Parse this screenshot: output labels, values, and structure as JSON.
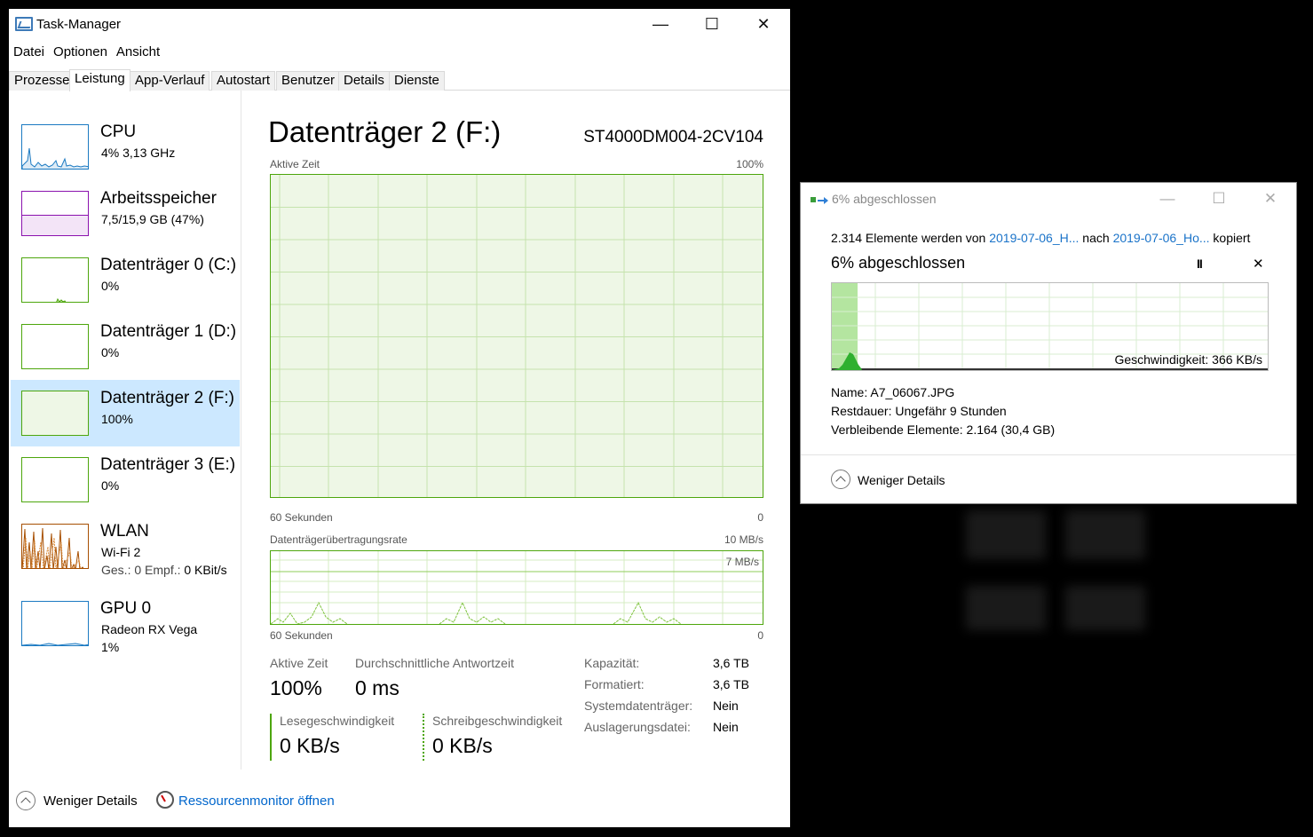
{
  "window": {
    "title": "Task-Manager",
    "minimize": "—",
    "maximize": "☐",
    "close": "✕"
  },
  "menu": [
    "Datei",
    "Optionen",
    "Ansicht"
  ],
  "tabs": [
    "Prozesse",
    "Leistung",
    "App-Verlauf",
    "Autostart",
    "Benutzer",
    "Details",
    "Dienste"
  ],
  "sidebar": {
    "items": [
      {
        "name": "CPU",
        "sub": "4%  3,13 GHz",
        "color": "#1b7ac2"
      },
      {
        "name": "Arbeitsspeicher",
        "sub": "7,5/15,9 GB (47%)",
        "color": "#8b12ae"
      },
      {
        "name": "Datenträger 0 (C:)",
        "sub": "0%",
        "color": "#4da60c"
      },
      {
        "name": "Datenträger 1 (D:)",
        "sub": "0%",
        "color": "#4da60c"
      },
      {
        "name": "Datenträger 2 (F:)",
        "sub": "100%",
        "color": "#4da60c"
      },
      {
        "name": "Datenträger 3 (E:)",
        "sub": "0%",
        "color": "#4da60c"
      },
      {
        "name": "WLAN",
        "sub": "Wi-Fi 2",
        "sub2_a": "Ges.: 0",
        "sub2_b": " Empf.: ",
        "sub2_c": "0 KBit/s",
        "color": "#a74f01"
      },
      {
        "name": "GPU 0",
        "sub": "Radeon RX Vega",
        "sub2": "1%",
        "color": "#1b7ac2"
      }
    ]
  },
  "main": {
    "title": "Datenträger 2 (F:)",
    "model": "ST4000DM004-2CV104",
    "graph1": {
      "label": "Aktive Zeit",
      "max": "100%",
      "xlabel": "60 Sekunden",
      "xmin": "0"
    },
    "graph2": {
      "label": "Datenträgerübertragungsrate",
      "max": "10 MB/s",
      "inner": "7 MB/s",
      "xlabel": "60 Sekunden",
      "xmin": "0"
    },
    "stats": {
      "active_label": "Aktive Zeit",
      "active_value": "100%",
      "resp_label": "Durchschnittliche Antwortzeit",
      "resp_value": "0 ms",
      "read_label": "Lesegeschwindigkeit",
      "read_value": "0 KB/s",
      "write_label": "Schreibgeschwindigkeit",
      "write_value": "0 KB/s"
    },
    "props": [
      {
        "k": "Kapazität:",
        "v": "3,6 TB"
      },
      {
        "k": "Formatiert:",
        "v": "3,6 TB"
      },
      {
        "k": "Systemdatenträger:",
        "v": "Nein"
      },
      {
        "k": "Auslagerungsdatei:",
        "v": "Nein"
      }
    ]
  },
  "footer": {
    "less_details": "Weniger Details",
    "resmon": "Ressourcenmonitor öffnen"
  },
  "copy": {
    "title": "6% abgeschlossen",
    "line_pre": "2.314 Elemente werden von ",
    "src": "2019-07-06_H...",
    "line_mid": " nach ",
    "dst": "2019-07-06_Ho...",
    "line_post": " kopiert",
    "pct": "6% abgeschlossen",
    "progress": 0.06,
    "pause": "II",
    "cancel": "✕",
    "speed": "Geschwindigkeit: 366 KB/s",
    "name": "Name:  A7_06067.JPG",
    "rest": "Restdauer:  Ungefähr 9 Stunden",
    "remain": "Verbleibende Elemente:  2.164 (30,4 GB)",
    "less_details": "Weniger Details"
  }
}
